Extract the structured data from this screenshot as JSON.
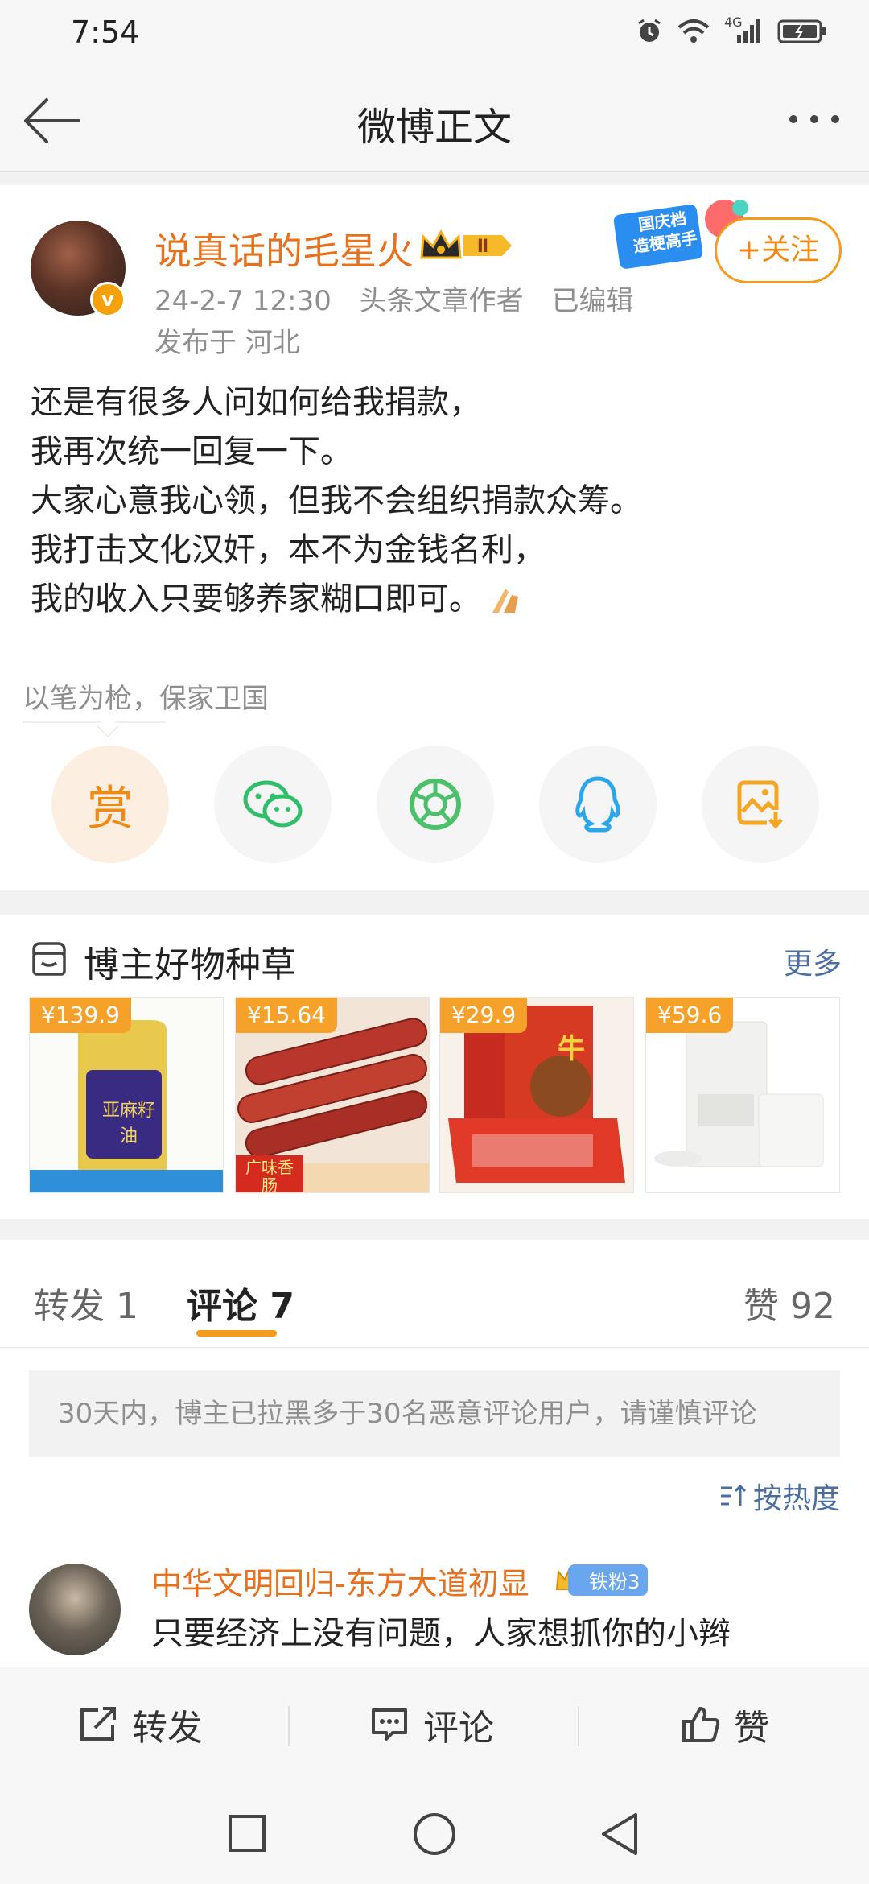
{
  "status_bar": {
    "time": "7:54",
    "network": "4G"
  },
  "nav": {
    "title": "微博正文"
  },
  "post": {
    "author": "说真话的毛星火",
    "level_badge": "Ⅱ",
    "verified_mark": "v",
    "promo_sticker": [
      "国庆档",
      "造梗高手"
    ],
    "follow_label": "+关注",
    "date": "24-2-7 12:30",
    "author_title": "头条文章作者",
    "edited": "已编辑",
    "location": "发布于 河北",
    "lines": [
      "还是有很多人问如何给我捐款，",
      "我再次统一回复一下。",
      "大家心意我心领，但我不会组织捐款众筹。",
      "我打击文化汉奸，本不为金钱名利，",
      "我的收入只要够养家糊口即可。"
    ],
    "topic": "以笔为枪，保家卫国",
    "reward_label": "赏",
    "share_icons": [
      "wechat-icon",
      "moments-icon",
      "qq-icon",
      "save-image-icon"
    ]
  },
  "goods": {
    "title": "博主好物种草",
    "more": "更多",
    "items": [
      {
        "price": "¥139.9",
        "caption": "亚麻籽油"
      },
      {
        "price": "¥15.64",
        "caption": "广味香肠"
      },
      {
        "price": "¥29.9",
        "caption": "牛"
      },
      {
        "price": "¥59.6",
        "caption": ""
      }
    ]
  },
  "tabs": {
    "repost": "转发 1",
    "comment": "评论 7",
    "like": "赞 92"
  },
  "comments": {
    "notice": "30天内，博主已拉黑多于30名恶意评论用户，请谨慎评论",
    "sort_label": "按热度",
    "items": [
      {
        "author": "中华文明回归-东方大道初显",
        "badge": "铁粉3",
        "text": "只要经济上没有问题，人家想抓你的小辫"
      }
    ]
  },
  "actions": {
    "repost": "转发",
    "comment": "评论",
    "like": "赞"
  },
  "colors": {
    "accent": "#f39b1a",
    "author": "#e8711d",
    "link": "#4a6ea0"
  }
}
